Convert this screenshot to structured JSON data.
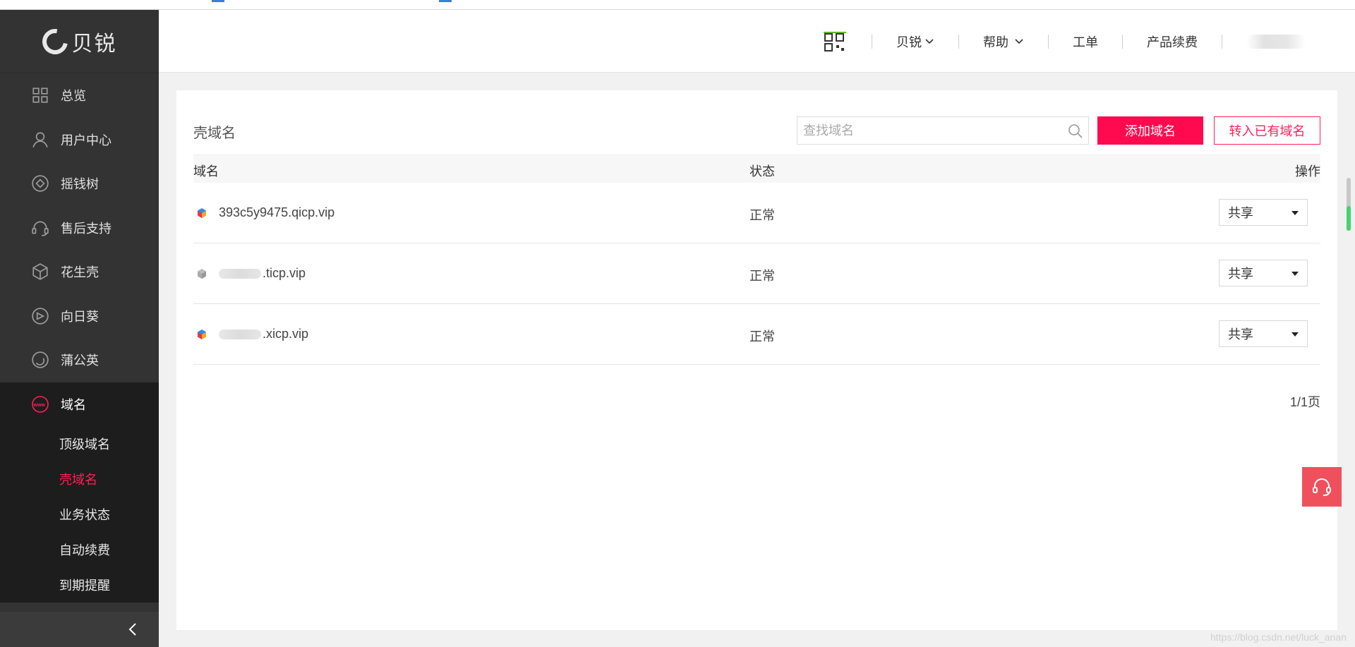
{
  "sidebar": {
    "logo_text": "贝锐",
    "items": [
      {
        "label": "总览",
        "icon": "grid-icon"
      },
      {
        "label": "用户中心",
        "icon": "user-icon"
      },
      {
        "label": "摇钱树",
        "icon": "diamond-icon"
      },
      {
        "label": "售后支持",
        "icon": "headset-icon"
      },
      {
        "label": "花生壳",
        "icon": "cube-icon"
      },
      {
        "label": "向日葵",
        "icon": "remote-icon"
      },
      {
        "label": "蒲公英",
        "icon": "swirl-icon"
      }
    ],
    "domain_group": {
      "label": "域名",
      "icon": "www-icon",
      "sub_items": [
        "顶级域名",
        "壳域名",
        "业务状态",
        "自动续费",
        "到期提醒"
      ],
      "active_sub_item": "壳域名"
    },
    "collapse_icon": "chevron-left-icon"
  },
  "header": {
    "qr_icon": "qrcode-icon",
    "menu": [
      {
        "label": "贝锐",
        "has_dropdown": true
      },
      {
        "label": "帮助",
        "has_dropdown": true
      },
      {
        "label": "工单",
        "has_dropdown": false
      },
      {
        "label": "产品续费",
        "has_dropdown": false
      }
    ]
  },
  "main": {
    "title": "壳域名",
    "search": {
      "placeholder": "查找域名",
      "value": ""
    },
    "add_button": "添加域名",
    "transfer_button": "转入已有域名",
    "columns": [
      "域名",
      "状态",
      "操作"
    ],
    "rows": [
      {
        "domain_suffix": "393c5y9475.qicp.vip",
        "blurred": false,
        "status": "正常",
        "action": "共享",
        "icon_color": "colorful"
      },
      {
        "domain_suffix": ".ticp.vip",
        "blurred": true,
        "status": "正常",
        "action": "共享",
        "icon_color": "gray"
      },
      {
        "domain_suffix": ".xicp.vip",
        "blurred": true,
        "status": "正常",
        "action": "共享",
        "icon_color": "colorful"
      }
    ],
    "pager": "1/1页"
  },
  "watermark": "https://blog.csdn.net/luck_anan",
  "colors": {
    "accent": "#ff0a4e",
    "sidebar_bg": "#333333",
    "active_group_bg": "#1d1d1d"
  }
}
